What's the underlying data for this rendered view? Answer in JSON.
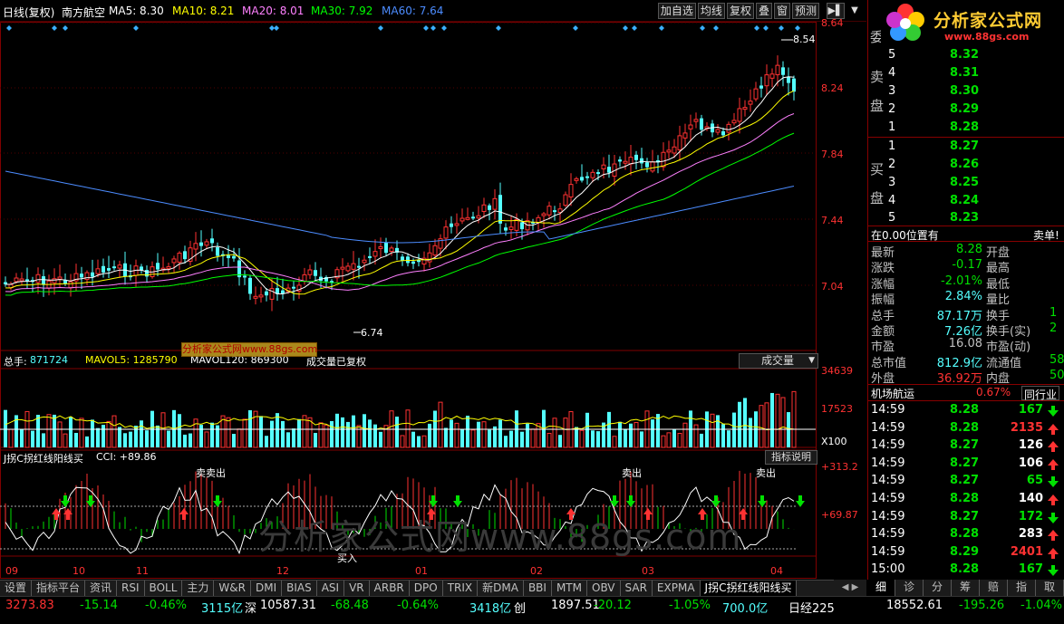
{
  "toolbar": {
    "period": "日线(复权)",
    "stock": "南方航空",
    "ma5": "MA5: 8.30",
    "ma10": "MA10: 8.21",
    "ma20": "MA20: 8.01",
    "ma30": "MA30: 7.92",
    "ma60": "MA60: 7.64",
    "buttons": [
      "加自选",
      "均线",
      "复权",
      "叠",
      "窗",
      "预测"
    ]
  },
  "colors": {
    "up": "#ff3232",
    "down": "#54ffff",
    "ma5": "#ffffff",
    "ma10": "#ffff00",
    "ma20": "#ff80ff",
    "ma30": "#00ff00",
    "ma60": "#4c8cff",
    "bg": "#000000",
    "grid": "#800000"
  },
  "price_axis": [
    "8.64",
    "8.24",
    "7.84",
    "7.44",
    "7.04"
  ],
  "annotations": {
    "high": "8.54",
    "low": "6.74"
  },
  "volume": {
    "label": "总手:",
    "value": "871724",
    "mavol5": "MAVOL5: 1285790",
    "mavol120": "MAVOL120: 869300",
    "note": "成交量已复权",
    "selector": "成交量",
    "axis": [
      "34639",
      "17523"
    ],
    "unit": "X100"
  },
  "watermark_box": "分析家公式网www.88gs.com",
  "indicator": {
    "name": "J拐C拐红线阳线买",
    "cci": "CCI: +89.86",
    "help": "指标说明",
    "axis": [
      "+313.2",
      "+69.87"
    ],
    "signals": [
      "卖卖出",
      "卖出",
      "卖出",
      "买入"
    ]
  },
  "watermark": "分析家公式网www.88gs.com",
  "dates": [
    "09",
    "10",
    "11",
    "12",
    "01",
    "02",
    "03",
    "04"
  ],
  "logo": {
    "title": "分析家公式网",
    "url": "www.88gs.com"
  },
  "orderbook": {
    "sell_label": [
      "委",
      "卖",
      "盘"
    ],
    "buy_label": [
      "买",
      "盘"
    ],
    "asks": [
      {
        "idx": "5",
        "price": "8.32"
      },
      {
        "idx": "4",
        "price": "8.31"
      },
      {
        "idx": "3",
        "price": "8.30"
      },
      {
        "idx": "2",
        "price": "8.29"
      },
      {
        "idx": "1",
        "price": "8.28"
      }
    ],
    "bids": [
      {
        "idx": "1",
        "price": "8.27"
      },
      {
        "idx": "2",
        "price": "8.26"
      },
      {
        "idx": "3",
        "price": "8.25"
      },
      {
        "idx": "4",
        "price": "8.24"
      },
      {
        "idx": "5",
        "price": "8.23"
      }
    ]
  },
  "position": {
    "text": "在0.00位置有",
    "action": "卖单!"
  },
  "stats": [
    {
      "label": "最新",
      "value": "8.28",
      "color": "#00e000",
      "label2": "开盘"
    },
    {
      "label": "涨跌",
      "value": "-0.17",
      "color": "#00e000",
      "label2": "最高"
    },
    {
      "label": "涨幅",
      "value": "-2.01%",
      "color": "#00e000",
      "label2": "最低"
    },
    {
      "label": "振幅",
      "value": "2.84%",
      "color": "#54ffff",
      "label2": "量比"
    },
    {
      "label": "总手",
      "value": "87.17万",
      "color": "#54ffff",
      "label2": "换手",
      "value2": "1"
    },
    {
      "label": "金额",
      "value": "7.26亿",
      "color": "#54ffff",
      "label2": "换手(实)",
      "value2": "2"
    },
    {
      "label": "市盈",
      "value": "16.08",
      "color": "#c0c0c0",
      "label2": "市盈(动)"
    },
    {
      "label": "总市值",
      "value": "812.9亿",
      "color": "#54ffff",
      "label2": "流通值",
      "value2": "58"
    },
    {
      "label": "外盘",
      "value": "36.92万",
      "color": "#ff3232",
      "label2": "内盘",
      "value2": "50"
    }
  ],
  "sector": {
    "name": "机场航运",
    "change": "0.67%",
    "tab": "同行业"
  },
  "trades": [
    {
      "time": "14:59",
      "price": "8.28",
      "vol": "167",
      "dir": "down"
    },
    {
      "time": "14:59",
      "price": "8.28",
      "vol": "2135",
      "dir": "up"
    },
    {
      "time": "14:59",
      "price": "8.27",
      "vol": "126",
      "dir": "up"
    },
    {
      "time": "14:59",
      "price": "8.27",
      "vol": "106",
      "dir": "up"
    },
    {
      "time": "14:59",
      "price": "8.27",
      "vol": "65",
      "dir": "down"
    },
    {
      "time": "14:59",
      "price": "8.28",
      "vol": "140",
      "dir": "up"
    },
    {
      "time": "14:59",
      "price": "8.27",
      "vol": "172",
      "dir": "down"
    },
    {
      "time": "14:59",
      "price": "8.28",
      "vol": "283",
      "dir": "up"
    },
    {
      "time": "14:59",
      "price": "8.29",
      "vol": "2401",
      "dir": "up"
    },
    {
      "time": "15:00",
      "price": "8.28",
      "vol": "167",
      "dir": "down"
    }
  ],
  "tabs": [
    "设置",
    "指标平台",
    "资讯",
    "RSI",
    "BOLL",
    "主力",
    "W&R",
    "DMI",
    "BIAS",
    "ASI",
    "VR",
    "ARBR",
    "DPO",
    "TRIX",
    "新DMA",
    "BBI",
    "MTM",
    "OBV",
    "SAR",
    "EXPMA",
    "J拐C拐红线阳线买"
  ],
  "right_tabs": [
    "细",
    "诊",
    "分",
    "筹",
    "赔",
    "指",
    "取"
  ],
  "status": [
    {
      "text": "3273.83",
      "color": "#ff3232"
    },
    {
      "text": "-15.14",
      "color": "#00e000"
    },
    {
      "text": "-0.46%",
      "color": "#00e000"
    },
    {
      "text": "3115亿",
      "color": "#54ffff"
    },
    {
      "text": "深",
      "color": "#fff"
    },
    {
      "text": "10587.31",
      "color": "#fff"
    },
    {
      "text": "-68.48",
      "color": "#00e000"
    },
    {
      "text": "-0.64%",
      "color": "#00e000"
    },
    {
      "text": "3418亿",
      "color": "#54ffff"
    },
    {
      "text": "创",
      "color": "#fff"
    },
    {
      "text": "1897.51",
      "color": "#fff"
    },
    {
      "text": "-20.12",
      "color": "#00e000"
    },
    {
      "text": "-1.05%",
      "color": "#00e000"
    },
    {
      "text": "700.0亿",
      "color": "#54ffff"
    },
    {
      "text": "日经225",
      "color": "#fff"
    },
    {
      "text": "18552.61",
      "color": "#fff"
    },
    {
      "text": "-195.26",
      "color": "#00e000"
    },
    {
      "text": "-1.04%",
      "color": "#00e000"
    }
  ]
}
